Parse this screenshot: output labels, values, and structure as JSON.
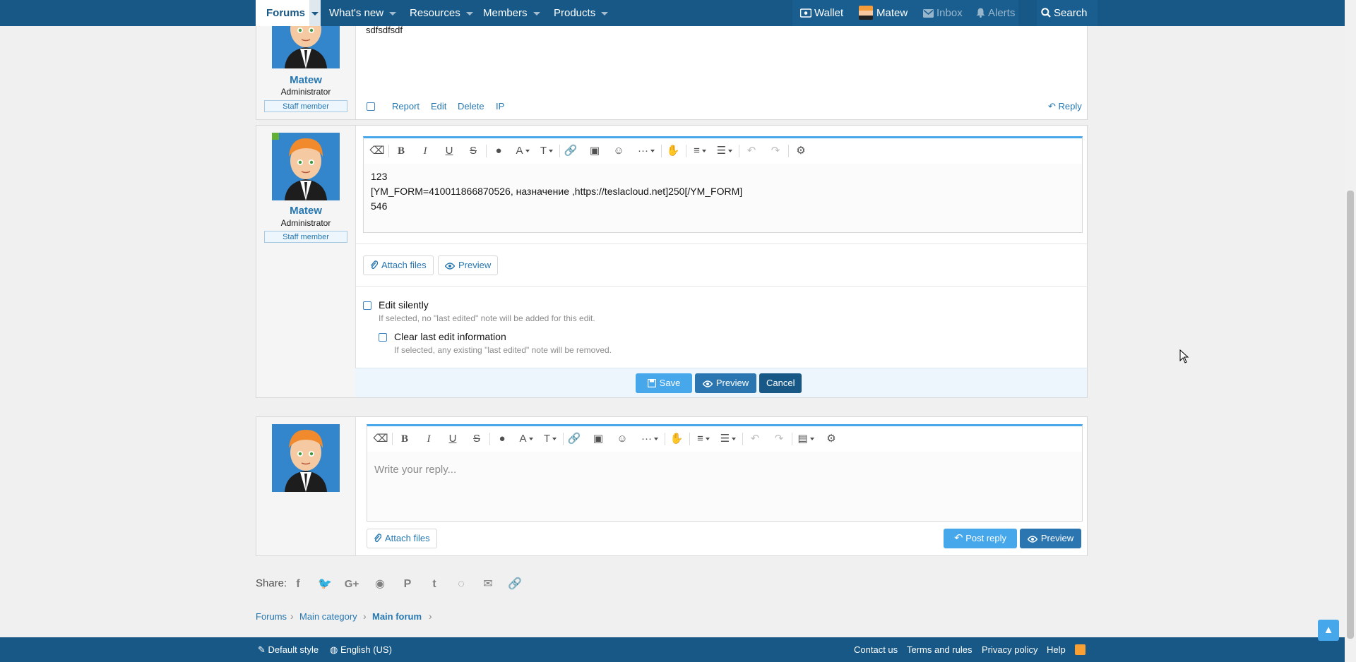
{
  "nav": {
    "tabs": [
      {
        "label": "Forums",
        "icon": "chevron-down-icon"
      },
      {
        "label": "What's new",
        "icon": "chevron-down-icon"
      },
      {
        "label": "Resources",
        "icon": "chevron-down-icon"
      },
      {
        "label": "Members",
        "icon": "chevron-down-icon"
      },
      {
        "label": "Products",
        "icon": "chevron-down-icon"
      }
    ],
    "right": {
      "wallet": "Wallet",
      "user": "Matew",
      "inbox": "Inbox",
      "alerts": "Alerts",
      "search": "Search"
    },
    "colors": {
      "bar": "#185886",
      "accent": "#47a7eb"
    }
  },
  "post1": {
    "username": "Matew",
    "usertitle": "Administrator",
    "banner": "Staff member",
    "text": "sdfsdfsdf",
    "actions": {
      "report": "Report",
      "edit": "Edit",
      "delete": "Delete",
      "ip": "IP",
      "reply": "Reply"
    }
  },
  "edit_form": {
    "username": "Matew",
    "usertitle": "Administrator",
    "banner": "Staff member",
    "content_lines": [
      "123",
      "[YM_FORM=410011866870526, назначение ,https://teslacloud.net]250[/YM_FORM]",
      "546"
    ],
    "attach_label": "Attach files",
    "preview_label": "Preview",
    "edit_silently": {
      "label": "Edit silently",
      "hint": "If selected, no \"last edited\" note will be added for this edit."
    },
    "clear_edit": {
      "label": "Clear last edit information",
      "hint": "If selected, any existing \"last edited\" note will be removed."
    },
    "buttons": {
      "save": "Save",
      "preview": "Preview",
      "cancel": "Cancel"
    }
  },
  "quick_reply": {
    "placeholder": "Write your reply...",
    "attach_label": "Attach files",
    "post_reply": "Post reply",
    "preview": "Preview"
  },
  "share": {
    "label": "Share:",
    "icons": [
      "facebook-icon",
      "twitter-icon",
      "google-plus-icon",
      "reddit-icon",
      "pinterest-icon",
      "tumblr-icon",
      "whatsapp-icon",
      "email-icon",
      "link-icon"
    ]
  },
  "breadcrumb": {
    "items": [
      "Forums",
      "Main category",
      "Main forum"
    ]
  },
  "footer": {
    "style": "Default style",
    "language": "English (US)",
    "links": [
      "Contact us",
      "Terms and rules",
      "Privacy policy",
      "Help"
    ]
  }
}
